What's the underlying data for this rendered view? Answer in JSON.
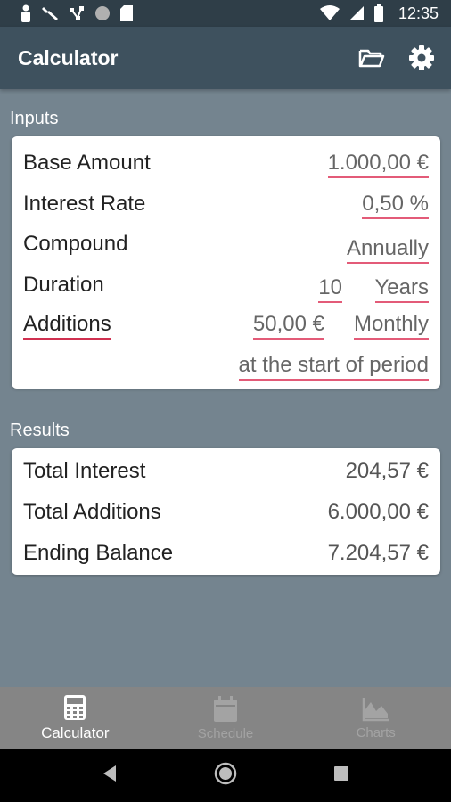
{
  "status_bar": {
    "time": "12:35",
    "left_icons": [
      "person-icon",
      "wrench-icon",
      "network-icon",
      "circle-icon",
      "sd-card-icon"
    ],
    "right_icons": [
      "wifi-icon",
      "signal-icon",
      "battery-icon"
    ]
  },
  "app_bar": {
    "title": "Calculator",
    "actions": [
      "folder-open-icon",
      "gear-icon"
    ]
  },
  "inputs": {
    "section_title": "Inputs",
    "base_amount": {
      "label": "Base Amount",
      "value": "1.000,00 €"
    },
    "interest_rate": {
      "label": "Interest Rate",
      "value": "0,50 %"
    },
    "compound": {
      "label": "Compound",
      "value": "Annually"
    },
    "duration": {
      "label": "Duration",
      "value": "10",
      "unit": "Years"
    },
    "additions": {
      "label": "Additions",
      "amount": "50,00 €",
      "frequency": "Monthly",
      "timing": "at the start of period"
    }
  },
  "results": {
    "section_title": "Results",
    "total_interest": {
      "label": "Total Interest",
      "value": "204,57 €"
    },
    "total_additions": {
      "label": "Total Additions",
      "value": "6.000,00 €"
    },
    "ending_balance": {
      "label": "Ending Balance",
      "value": "7.204,57 €"
    }
  },
  "bottom_nav": {
    "items": [
      {
        "label": "Calculator",
        "icon": "calculator-icon",
        "active": true
      },
      {
        "label": "Schedule",
        "icon": "calendar-icon",
        "active": false
      },
      {
        "label": "Charts",
        "icon": "area-chart-icon",
        "active": false
      }
    ]
  },
  "colors": {
    "background": "#74848f",
    "app_bar": "#3e515e",
    "status_bar": "#2f3e48",
    "underline_accent": "#e35b78",
    "bottom_nav": "#858585"
  }
}
